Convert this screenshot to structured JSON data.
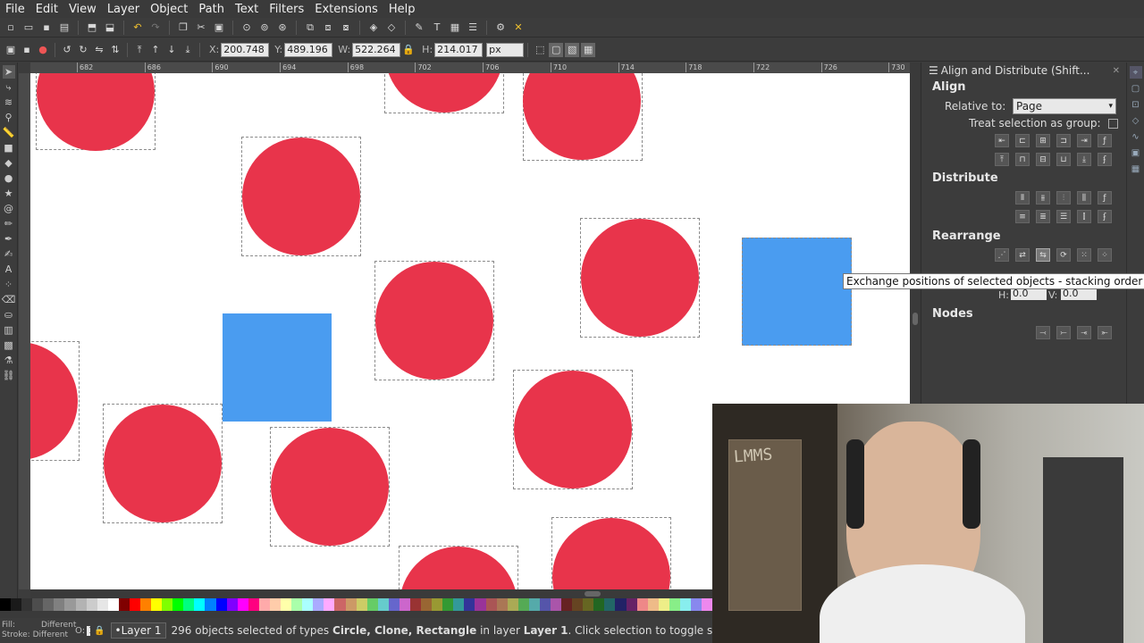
{
  "menu": [
    "File",
    "Edit",
    "View",
    "Layer",
    "Object",
    "Path",
    "Text",
    "Filters",
    "Extensions",
    "Help"
  ],
  "controls": {
    "x_label": "X:",
    "x_value": "200.748",
    "y_label": "Y:",
    "y_value": "489.196",
    "w_label": "W:",
    "w_value": "522.264",
    "h_label": "H:",
    "h_value": "214.017",
    "unit": "px"
  },
  "ruler_ticks": [
    "682",
    "686",
    "690",
    "694",
    "698",
    "702",
    "706",
    "710",
    "714",
    "718",
    "722",
    "726",
    "730"
  ],
  "panel": {
    "title": "Align and Distribute (Shift...",
    "align_heading": "Align",
    "relative_label": "Relative to:",
    "relative_value": "Page",
    "group_label": "Treat selection as group:",
    "distribute_heading": "Distribute",
    "rearrange_heading": "Rearrange",
    "nodes_heading": "Nodes",
    "h_label": "H:",
    "h_value": "0.0",
    "v_label": "V:",
    "v_value": "0.0"
  },
  "tooltip": "Exchange positions of selected objects - stacking order",
  "status": {
    "fill_label": "Fill:",
    "fill_value": "Different",
    "stroke_label": "Stroke:",
    "stroke_value": "Different",
    "opacity_label": "O:",
    "opacity_value": "100",
    "layer": "•Layer 1",
    "message_pre": "296 objects selected of types ",
    "message_types": "Circle, Clone, Rectangle",
    "message_mid": " in layer ",
    "message_layer": "Layer 1",
    "message_post": ". Click selection to toggle scale/rotation handles."
  },
  "webcam_sign": "LMMS",
  "colors": {
    "circle": "#e8344b",
    "square": "#4a9cf0",
    "canvas": "#ffffff",
    "ui_bg": "#3c3c3c"
  }
}
